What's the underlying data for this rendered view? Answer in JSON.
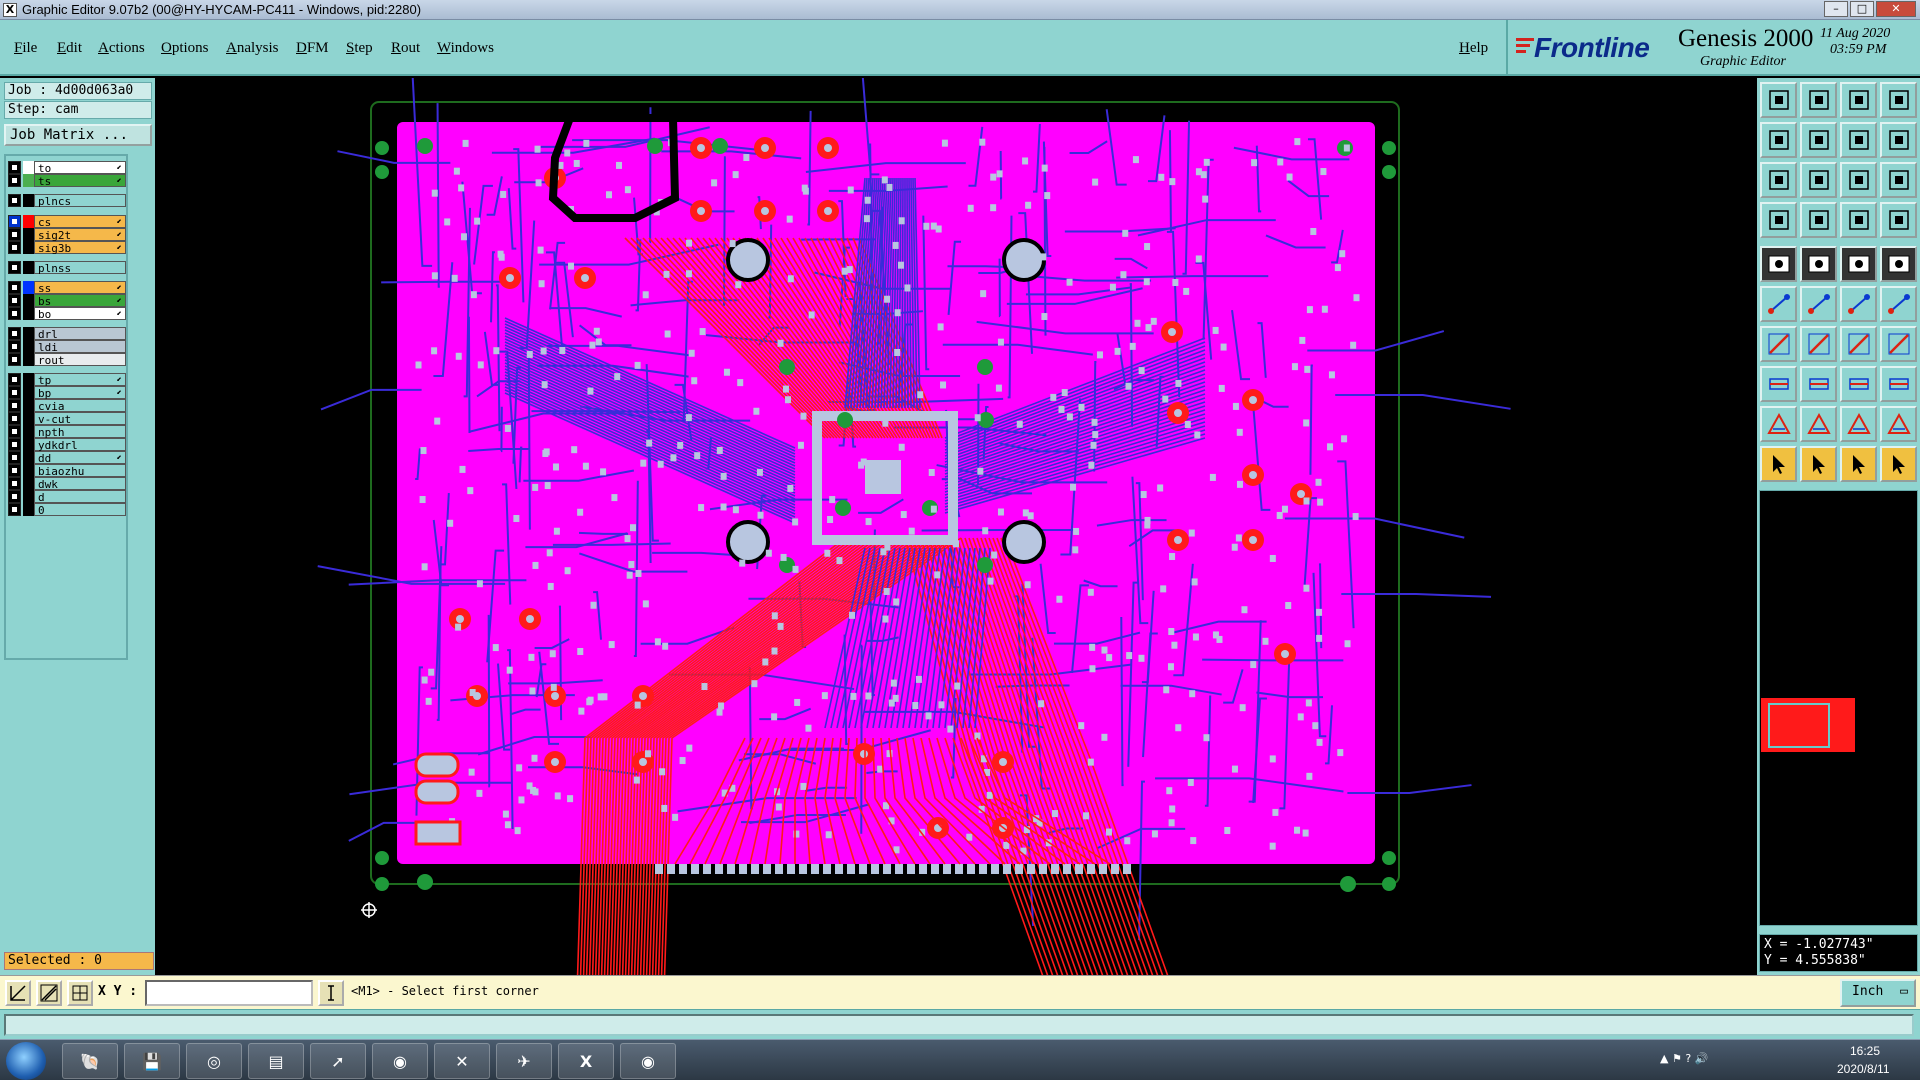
{
  "window": {
    "title": "Graphic Editor 9.07b2 (00@HY-HYCAM-PC411 - Windows, pid:2280)",
    "controls": [
      "minimize-icon",
      "maximize-icon",
      "close-icon"
    ]
  },
  "menu": {
    "items": [
      "File",
      "Edit",
      "Actions",
      "Options",
      "Analysis",
      "DFM",
      "Step",
      "Rout",
      "Windows"
    ],
    "help": "Help"
  },
  "branding": {
    "company": "Frontline",
    "product": "Genesis 2000",
    "subtitle": "Graphic Editor",
    "date": "11 Aug 2020",
    "time": "03:59 PM"
  },
  "job": {
    "job_line": "Job : 4d00d063a0",
    "step_line": "Step: cam",
    "job_matrix_button": "Job Matrix ..."
  },
  "layers": [
    {
      "name": "to",
      "color": "#ffffff",
      "name_bg": "#ffffff",
      "arrow": true
    },
    {
      "name": "ts",
      "color": "#4caf50",
      "name_bg": "#3aa63a",
      "arrow": true
    },
    {
      "name": "plncs",
      "color": "#000000",
      "name_bg": "#8fd4d0",
      "arrow": false
    },
    {
      "name": "cs",
      "color": "#ff0000",
      "name_bg": "#f5b84a",
      "arrow": true,
      "active": true
    },
    {
      "name": "sig2t",
      "color": "#000000",
      "name_bg": "#f5b84a",
      "arrow": true
    },
    {
      "name": "sig3b",
      "color": "#000000",
      "name_bg": "#f5b84a",
      "arrow": true
    },
    {
      "name": "plnss",
      "color": "#000000",
      "name_bg": "#8fd4d0",
      "arrow": false
    },
    {
      "name": "ss",
      "color": "#0033ff",
      "name_bg": "#f5b84a",
      "arrow": true
    },
    {
      "name": "bs",
      "color": "#000000",
      "name_bg": "#3aa63a",
      "arrow": true
    },
    {
      "name": "bo",
      "color": "#000000",
      "name_bg": "#ffffff",
      "arrow": true
    },
    {
      "name": "drl",
      "color": "#000000",
      "name_bg": "#b9c7d2",
      "arrow": false
    },
    {
      "name": "ldi",
      "color": "#000000",
      "name_bg": "#b9c7d2",
      "arrow": false
    },
    {
      "name": "rout",
      "color": "#000000",
      "name_bg": "#e8ecee",
      "arrow": false
    },
    {
      "name": "tp",
      "color": "#000000",
      "name_bg": "#8fd4d0",
      "arrow": true
    },
    {
      "name": "bp",
      "color": "#000000",
      "name_bg": "#8fd4d0",
      "arrow": true
    },
    {
      "name": "cvia",
      "color": "#000000",
      "name_bg": "#8fd4d0",
      "arrow": false
    },
    {
      "name": "v-cut",
      "color": "#000000",
      "name_bg": "#8fd4d0",
      "arrow": false
    },
    {
      "name": "npth",
      "color": "#000000",
      "name_bg": "#8fd4d0",
      "arrow": false
    },
    {
      "name": "ydkdrl",
      "color": "#000000",
      "name_bg": "#8fd4d0",
      "arrow": false
    },
    {
      "name": "dd",
      "color": "#000000",
      "name_bg": "#8fd4d0",
      "arrow": true
    },
    {
      "name": "biaozhu",
      "color": "#000000",
      "name_bg": "#8fd4d0",
      "arrow": false
    },
    {
      "name": "dwk",
      "color": "#000000",
      "name_bg": "#8fd4d0",
      "arrow": false
    },
    {
      "name": "d",
      "color": "#000000",
      "name_bg": "#8fd4d0",
      "arrow": false
    },
    {
      "name": "0",
      "color": "#000000",
      "name_bg": "#8fd4d0",
      "arrow": false
    }
  ],
  "selected": "Selected : 0",
  "coords": {
    "x": "X = -1.027743\"",
    "y": "Y = 4.555838\""
  },
  "command": {
    "xy_label": "X Y :",
    "xy_value": "",
    "prompt": "<M1> - Select first corner",
    "units": "Inch"
  },
  "taskbar": {
    "apps": [
      "shell-icon",
      "save-disk-icon",
      "red-swirl-app-icon",
      "notepad-icon",
      "green-arrow-app-icon",
      "eye-viewer-icon",
      "x-app-icon",
      "telegram-icon",
      "excel-icon",
      "eye-viewer-icon-2"
    ],
    "clock_time": "16:25",
    "clock_date": "2020/8/11"
  },
  "colors": {
    "panel_teal": "#8fd4d0",
    "board_magenta": "#ff00ff",
    "trace_blue": "#3a2bd9",
    "trace_red": "#ff1a1a",
    "pad_gray": "#b8c6e0",
    "selection_orange": "#f5b84a"
  }
}
